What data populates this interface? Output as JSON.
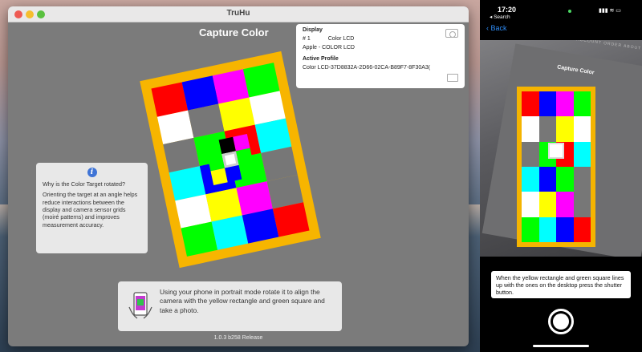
{
  "window": {
    "title": "TruHu"
  },
  "capture": {
    "title": "Capture Color"
  },
  "display_panel": {
    "header": "Display",
    "number_label": "# 1",
    "name": "Color LCD",
    "vendor": "Apple - COLOR LCD",
    "profile_header": "Active Profile",
    "profile": "Color LCD-37D8832A-2D66-02CA-B89F7-8F30A3("
  },
  "info": {
    "icon": "i",
    "question": "Why is the Color Target rotated?",
    "answer": "Orienting the target at an angle helps reduce interactions between the display and camera sensor grids (moiré patterns) and improves measurement accuracy."
  },
  "tip": {
    "text": "Using your phone in portrait mode rotate it to align the camera with the yellow rectangle and green square and take a photo."
  },
  "version": "1.0.3 b258 Release",
  "target_colors": [
    "#ff0000",
    "#0000ff",
    "#ff00ff",
    "#00ff00",
    "#ffffff",
    "#777777",
    "#ffff00",
    "#ffffff",
    "#777777",
    "#00ff00",
    "#ff0000",
    "#00ffff",
    "#00ffff",
    "#0000ff",
    "#00ff00",
    "#777777",
    "#ffffff",
    "#ffff00",
    "#ff00ff",
    "#777777",
    "#00ff00",
    "#00ffff",
    "#0000ff",
    "#ff0000"
  ],
  "phone": {
    "time": "17:20",
    "back_to": "◂ Search",
    "back_label": "Back",
    "signal": "▮▮▮ ≋ ▭",
    "menu_text": "ACCOUNT  ORDER  ABOUT",
    "capture_title": "Capture Color",
    "hint": "When the yellow rectangle and green square lines up with the ones on the desktop press the shutter button."
  },
  "colors": {
    "target_frame": "#f7b500",
    "info_icon": "#3f74d6",
    "link": "#2f8cf5"
  }
}
